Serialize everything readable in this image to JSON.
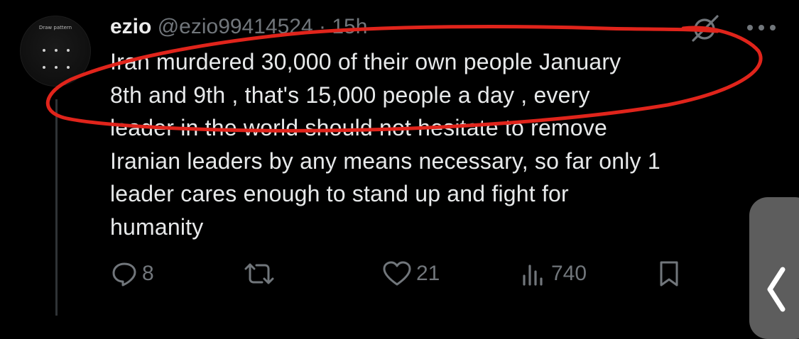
{
  "avatar": {
    "label": "Draw pattern"
  },
  "tweet": {
    "name": "ezio",
    "handle": "@ezio99414524",
    "separator": "·",
    "time": "15h",
    "text": "Iran murdered 30,000 of their own people January\n8th and 9th , that's 15,000 people a day , every\nleader in the world should not hesitate to remove\nIranian leaders by any means necessary, so far only 1\nleader cares enough to stand up and fight for\nhumanity"
  },
  "actions": {
    "replies": "8",
    "reposts": "",
    "likes": "21",
    "views": "740"
  },
  "icons": {
    "reply": "reply-icon",
    "repost": "repost-icon",
    "like": "heart-icon",
    "views": "views-chart-icon",
    "bookmark": "bookmark-icon",
    "grok": "grok-icon",
    "more": "more-icon",
    "back": "chevron-left-icon"
  },
  "colors": {
    "background": "#000000",
    "text": "#e7e9ea",
    "muted": "#71767b",
    "annotation": "#e0241b",
    "side_panel": "#5d5d5d"
  }
}
